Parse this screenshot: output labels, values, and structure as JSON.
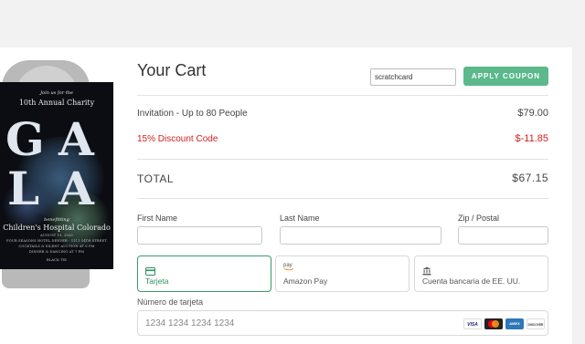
{
  "invite": {
    "script_top": "Join us for the",
    "event_title": "10th Annual Charity",
    "big_word_letters": [
      "G",
      "A",
      "L",
      "A"
    ],
    "benefitting": "benefitting",
    "organization": "Children's Hospital Colorado",
    "details_1": "AUGUST 15, 2020",
    "details_2": "FOUR SEASONS HOTEL DENVER · 1111 14TH STREET",
    "details_3": "COCKTAILS & SILENT AUCTION AT 6 PM",
    "details_4": "DINNER & DANCING AT 7 PM",
    "details_5": "BLACK TIE"
  },
  "cart": {
    "title": "Your Cart",
    "coupon_value": "scratchcard",
    "apply_coupon_label": "APPLY COUPON",
    "items": [
      {
        "label": "Invitation - Up to 80 People",
        "amount": "$79.00"
      },
      {
        "label": "15% Discount Code",
        "amount": "$-11.85"
      }
    ],
    "total_label": "TOTAL",
    "total_amount": "$67.15"
  },
  "form": {
    "first_name_label": "First Name",
    "last_name_label": "Last Name",
    "zip_label": "Zip / Postal"
  },
  "payment": {
    "tabs": [
      {
        "label": "Tarjeta",
        "icon": "credit-card-icon",
        "active": true
      },
      {
        "label": "Amazon Pay",
        "icon": "amazon-pay-icon",
        "active": false
      },
      {
        "label": "Cuenta bancaria de EE. UU.",
        "icon": "bank-icon",
        "active": false
      }
    ],
    "card_number_label": "Número de tarjeta",
    "card_number_placeholder": "1234 1234 1234 1234",
    "brands": [
      "VISA",
      "mastercard",
      "AMEX",
      "DISCOVER"
    ],
    "amazon_icon_text": "pay"
  },
  "colors": {
    "accent_green": "#5bb98c",
    "active_tab_border": "#3a9a6b",
    "discount_red": "#d21f1f"
  }
}
